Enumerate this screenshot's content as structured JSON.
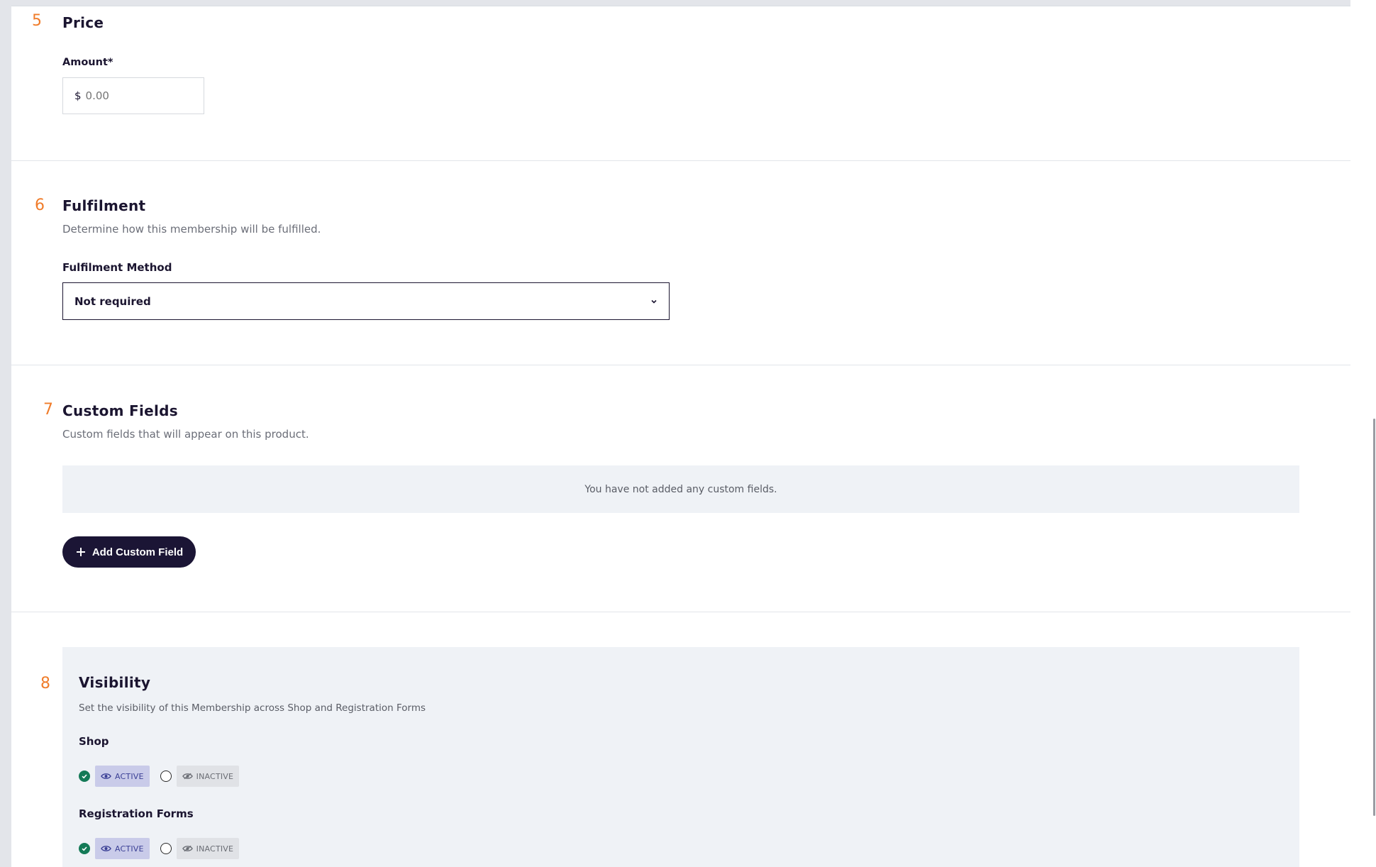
{
  "sections": {
    "price": {
      "number": "5",
      "title": "Price",
      "amount_label": "Amount*",
      "currency": "$",
      "amount_placeholder": "0.00"
    },
    "fulfilment": {
      "number": "6",
      "title": "Fulfilment",
      "description": "Determine how this membership will be fulfilled.",
      "method_label": "Fulfilment Method",
      "method_value": "Not required"
    },
    "custom_fields": {
      "number": "7",
      "title": "Custom Fields",
      "description": "Custom fields that will appear on this product.",
      "empty_message": "You have not added any custom fields.",
      "add_button_label": "Add Custom Field"
    },
    "visibility": {
      "number": "8",
      "title": "Visibility",
      "description": "Set the visibility of this Membership across Shop and Registration Forms",
      "groups": [
        {
          "label": "Shop",
          "active_label": "ACTIVE",
          "inactive_label": "INACTIVE",
          "selected": "active"
        },
        {
          "label": "Registration Forms",
          "active_label": "ACTIVE",
          "inactive_label": "INACTIVE",
          "selected": "active"
        }
      ]
    }
  },
  "colors": {
    "accent_orange": "#f07c2a",
    "primary_dark": "#1b1535",
    "active_green": "#147a57",
    "active_chip_bg": "#c9cbe9",
    "panel_bg": "#eff2f6"
  }
}
